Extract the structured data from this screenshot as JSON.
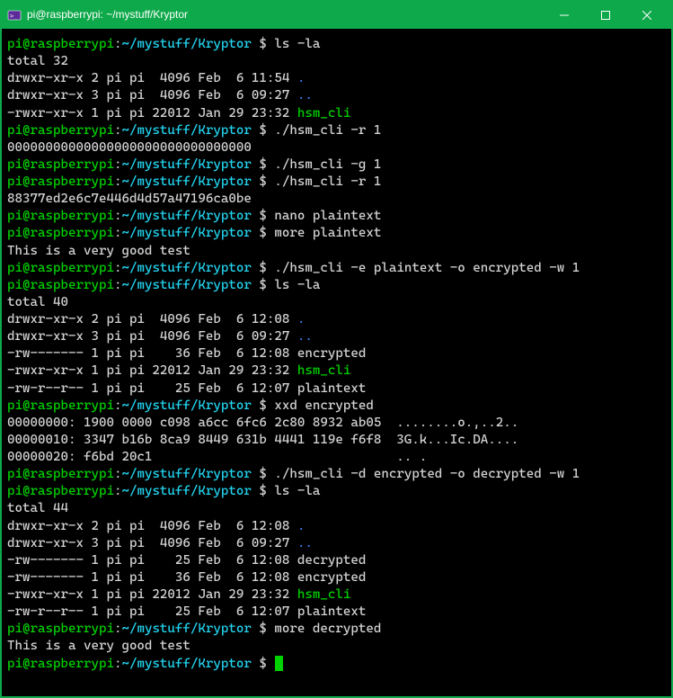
{
  "window": {
    "title": "pi@raspberrypi: ~/mystuff/Kryptor"
  },
  "prompt": {
    "user_host": "pi@raspberrypi",
    "sep": ":",
    "path": "~/mystuff/Kryptor",
    "end": " $ "
  },
  "entries": [
    {
      "type": "cmd",
      "text": "ls -la"
    },
    {
      "type": "out",
      "text": "total 32"
    },
    {
      "type": "lsline",
      "perm": "drwxr-xr-x 2 pi pi  4096 Feb  6 11:54 ",
      "name": ".",
      "cls": "blue"
    },
    {
      "type": "lsline",
      "perm": "drwxr-xr-x 3 pi pi  4096 Feb  6 09:27 ",
      "name": "..",
      "cls": "blue"
    },
    {
      "type": "lsline",
      "perm": "-rwxr-xr-x 1 pi pi 22012 Jan 29 23:32 ",
      "name": "hsm_cli",
      "cls": "green"
    },
    {
      "type": "cmd",
      "text": "./hsm_cli -r 1"
    },
    {
      "type": "out",
      "text": "00000000000000000000000000000000"
    },
    {
      "type": "cmd",
      "text": "./hsm_cli -g 1"
    },
    {
      "type": "cmd",
      "text": "./hsm_cli -r 1"
    },
    {
      "type": "out",
      "text": "88377ed2e6c7e446d4d57a47196ca0be"
    },
    {
      "type": "cmd",
      "text": "nano plaintext"
    },
    {
      "type": "cmd",
      "text": "more plaintext"
    },
    {
      "type": "out",
      "text": "This is a very good test"
    },
    {
      "type": "cmd",
      "text": "./hsm_cli -e plaintext -o encrypted -w 1"
    },
    {
      "type": "cmd",
      "text": "ls -la"
    },
    {
      "type": "out",
      "text": "total 40"
    },
    {
      "type": "lsline",
      "perm": "drwxr-xr-x 2 pi pi  4096 Feb  6 12:08 ",
      "name": ".",
      "cls": "blue"
    },
    {
      "type": "lsline",
      "perm": "drwxr-xr-x 3 pi pi  4096 Feb  6 09:27 ",
      "name": "..",
      "cls": "blue"
    },
    {
      "type": "lsline",
      "perm": "-rw------- 1 pi pi    36 Feb  6 12:08 ",
      "name": "encrypted",
      "cls": "grey"
    },
    {
      "type": "lsline",
      "perm": "-rwxr-xr-x 1 pi pi 22012 Jan 29 23:32 ",
      "name": "hsm_cli",
      "cls": "green"
    },
    {
      "type": "lsline",
      "perm": "-rw-r--r-- 1 pi pi    25 Feb  6 12:07 ",
      "name": "plaintext",
      "cls": "grey"
    },
    {
      "type": "cmd",
      "text": "xxd encrypted"
    },
    {
      "type": "out",
      "text": "00000000: 1900 0000 c098 a6cc 6fc6 2c80 8932 ab05  ........o.,..2.."
    },
    {
      "type": "out",
      "text": "00000010: 3347 b16b 8ca9 8449 631b 4441 119e f6f8  3G.k...Ic.DA...."
    },
    {
      "type": "out",
      "text": "00000020: f6bd 20c1                                .. ."
    },
    {
      "type": "cmd",
      "text": "./hsm_cli -d encrypted -o decrypted -w 1"
    },
    {
      "type": "cmd",
      "text": "ls -la"
    },
    {
      "type": "out",
      "text": "total 44"
    },
    {
      "type": "lsline",
      "perm": "drwxr-xr-x 2 pi pi  4096 Feb  6 12:08 ",
      "name": ".",
      "cls": "blue"
    },
    {
      "type": "lsline",
      "perm": "drwxr-xr-x 3 pi pi  4096 Feb  6 09:27 ",
      "name": "..",
      "cls": "blue"
    },
    {
      "type": "lsline",
      "perm": "-rw------- 1 pi pi    25 Feb  6 12:08 ",
      "name": "decrypted",
      "cls": "grey"
    },
    {
      "type": "lsline",
      "perm": "-rw------- 1 pi pi    36 Feb  6 12:08 ",
      "name": "encrypted",
      "cls": "grey"
    },
    {
      "type": "lsline",
      "perm": "-rwxr-xr-x 1 pi pi 22012 Jan 29 23:32 ",
      "name": "hsm_cli",
      "cls": "green"
    },
    {
      "type": "lsline",
      "perm": "-rw-r--r-- 1 pi pi    25 Feb  6 12:07 ",
      "name": "plaintext",
      "cls": "grey"
    },
    {
      "type": "cmd",
      "text": "more decrypted"
    },
    {
      "type": "out",
      "text": "This is a very good test"
    },
    {
      "type": "prompt_only"
    }
  ]
}
